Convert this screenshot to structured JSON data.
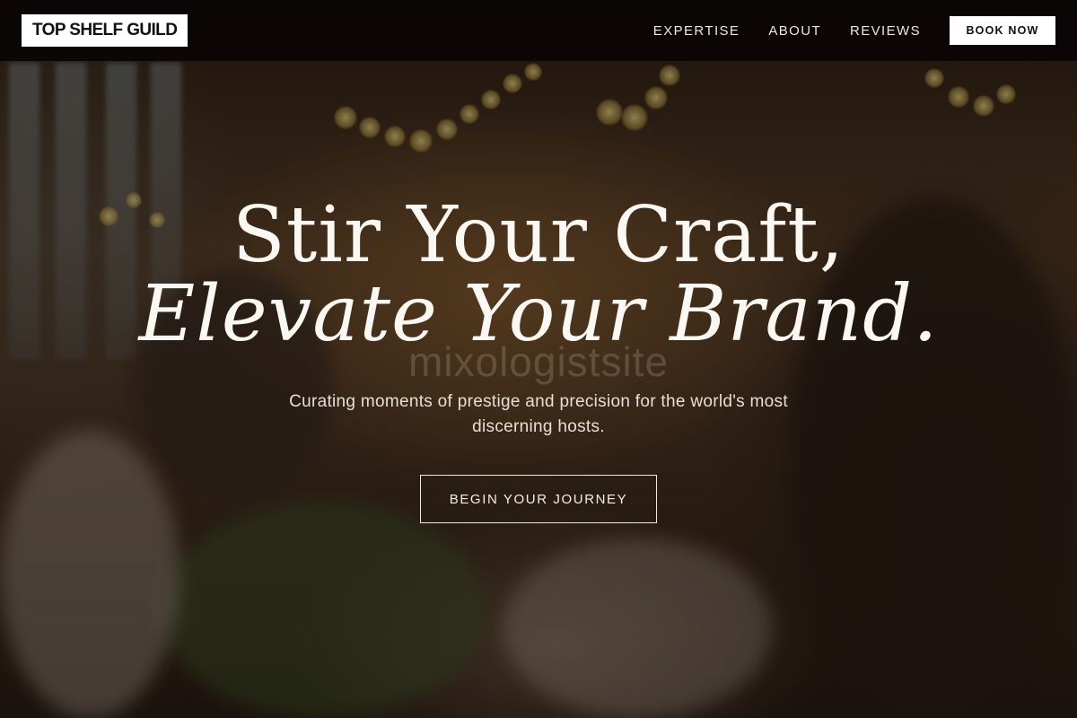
{
  "nav": {
    "logo": "TOP SHELF GUILD",
    "links": [
      "EXPERTISE",
      "ABOUT",
      "REVIEWS"
    ],
    "cta": "BOOK NOW"
  },
  "hero": {
    "headline_line1": "Stir Your Craft,",
    "headline_line2": "Elevate Your Brand.",
    "watermark": "mixologistsite",
    "subtitle": "Curating moments of prestige and precision for the world's most discerning hosts.",
    "cta": "BEGIN YOUR JOURNEY"
  },
  "colors": {
    "nav_background": "#080504",
    "text_light": "#fbf7f2",
    "button_white": "#ffffff"
  }
}
